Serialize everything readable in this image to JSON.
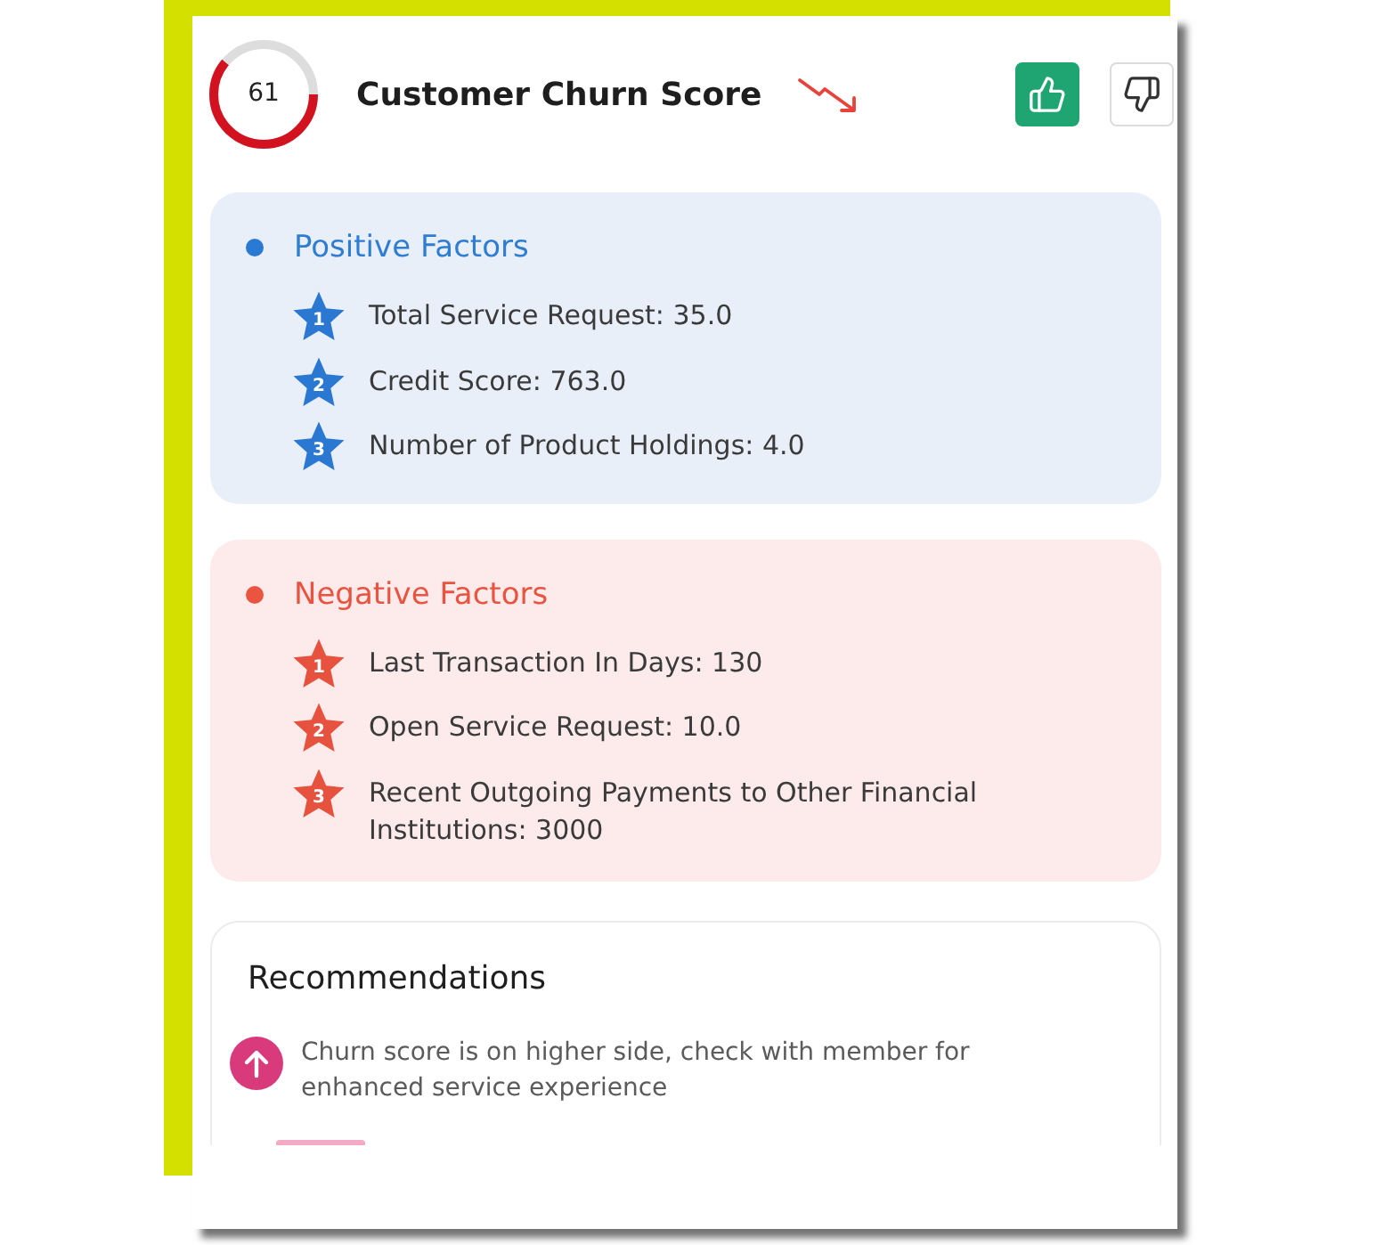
{
  "header": {
    "score": "61",
    "level": 0.61,
    "title": "Customer Churn Score",
    "trend": {
      "kind": "down"
    },
    "feedback": [
      {
        "kind": "up",
        "selected": true
      },
      {
        "kind": "down",
        "selected": false
      }
    ]
  },
  "factor_groups": [
    {
      "kind": "positive",
      "title": "Positive Factors",
      "items": [
        {
          "rank": "1",
          "text": "Total Service Request: 35.0"
        },
        {
          "rank": "2",
          "text": "Credit Score: 763.0"
        },
        {
          "rank": "3",
          "text": "Number of Product Holdings: 4.0"
        }
      ]
    },
    {
      "kind": "negative",
      "title": "Negative Factors",
      "items": [
        {
          "rank": "1",
          "text": "Last Transaction In Days: 130"
        },
        {
          "rank": "2",
          "text": "Open Service Request: 10.0"
        },
        {
          "rank": "3",
          "text": "Recent Outgoing Payments to Other Financial Institutions: 3000"
        }
      ]
    }
  ],
  "recommendations": {
    "title": "Recommendations",
    "items": [
      {
        "kind": "up",
        "text": "Churn score is on higher side, check with member for enhanced service experience"
      }
    ]
  }
}
